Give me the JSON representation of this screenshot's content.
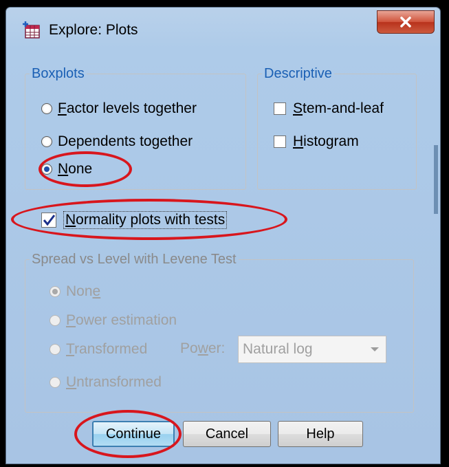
{
  "window": {
    "title": "Explore: Plots",
    "close_glyph": "X"
  },
  "boxplots": {
    "legend": "Boxplots",
    "options": [
      {
        "label": "Factor levels together",
        "mnemonic": "F",
        "rest": "actor levels together",
        "checked": false
      },
      {
        "label": "Dependents together",
        "checked": false
      },
      {
        "label": "None",
        "mnemonic": "N",
        "rest": "one",
        "checked": true
      }
    ]
  },
  "descriptive": {
    "legend": "Descriptive",
    "options": [
      {
        "label": "Stem-and-leaf",
        "mnemonic": "S",
        "rest": "tem-and-leaf",
        "checked": false
      },
      {
        "label": "Histogram",
        "mnemonic": "H",
        "rest": "istogram",
        "checked": false
      }
    ]
  },
  "normality": {
    "mnemonic": "N",
    "rest": "ormality plots with tests",
    "checked": true
  },
  "spread": {
    "legend": "Spread vs Level with Levene Test",
    "none_pre": "Non",
    "none_u": "e",
    "power_est_u": "P",
    "power_est_rest": "ower estimation",
    "transformed_u": "T",
    "transformed_rest": "ransformed",
    "power_label_pre": "Po",
    "power_label_u": "w",
    "power_label_rest": "er:",
    "power_value": "Natural log",
    "untransformed_u": "U",
    "untransformed_rest": "ntransformed"
  },
  "buttons": {
    "continue": "Continue",
    "cancel": "Cancel",
    "help": "Help"
  },
  "colors": {
    "annotation": "#d8161d",
    "legend": "#1a5fb4",
    "disabled": "#a0a0a0"
  }
}
